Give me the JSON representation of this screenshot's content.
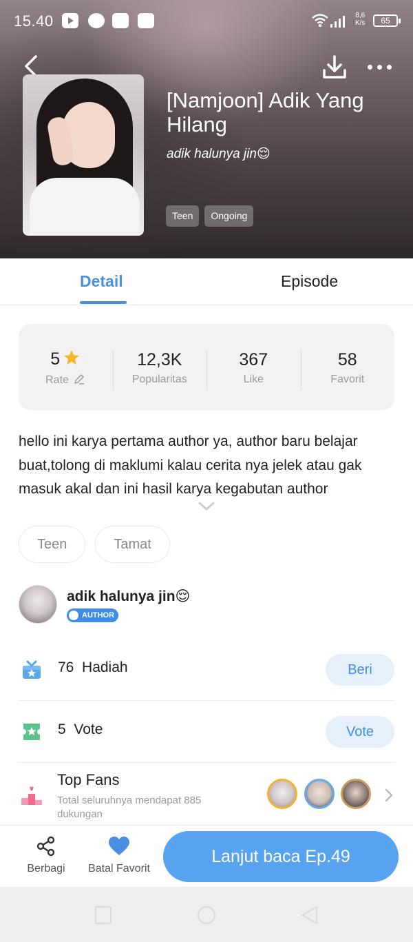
{
  "status_bar": {
    "time": "15.40",
    "net_speed": "8,6",
    "net_speed_unit": "K/s",
    "battery": "65",
    "icons": [
      "youtube-icon",
      "messenger-icon",
      "app-icon",
      "app-icon",
      "wifi-icon",
      "signal-icon",
      "battery-icon"
    ]
  },
  "header": {
    "title": "[Namjoon] Adik Yang Hilang",
    "author_line": "adik halunya jin😌",
    "tags": [
      "Teen",
      "Ongoing"
    ],
    "icons": {
      "back": "back-arrow-icon",
      "download": "download-icon",
      "more": "more-dots-icon"
    }
  },
  "tabs": [
    {
      "label": "Detail",
      "active": true
    },
    {
      "label": "Episode",
      "active": false
    }
  ],
  "stats": [
    {
      "value": "5",
      "label": "Rate"
    },
    {
      "value": "12,3K",
      "label": "Popularitas"
    },
    {
      "value": "367",
      "label": "Like"
    },
    {
      "value": "58",
      "label": "Favorit"
    }
  ],
  "description": "hello ini karya pertama author ya, author baru belajar buat,tolong di maklumi kalau cerita nya jelek atau gak masuk akal dan ini hasil karya kegabutan author",
  "genre_chips": [
    "Teen",
    "Tamat"
  ],
  "author": {
    "name": "adik halunya jin😌",
    "badge": "AUTHOR"
  },
  "gift": {
    "count": "76",
    "label": "Hadiah",
    "button": "Beri"
  },
  "vote": {
    "count": "5",
    "label": "Vote",
    "button": "Vote"
  },
  "top_fans": {
    "title": "Top Fans",
    "subtitle": "Total seluruhnya mendapat 885 dukungan"
  },
  "bottom_bar": {
    "share_label": "Berbagi",
    "unfavorite_label": "Batal Favorit",
    "continue_label": "Lanjut baca Ep.49"
  },
  "colors": {
    "accent": "#4a90e2",
    "cta": "#57a3f0",
    "gift_icon": "#5aa7f0",
    "vote_icon": "#5cc48a",
    "topfans_icon": "#f06a8a"
  }
}
